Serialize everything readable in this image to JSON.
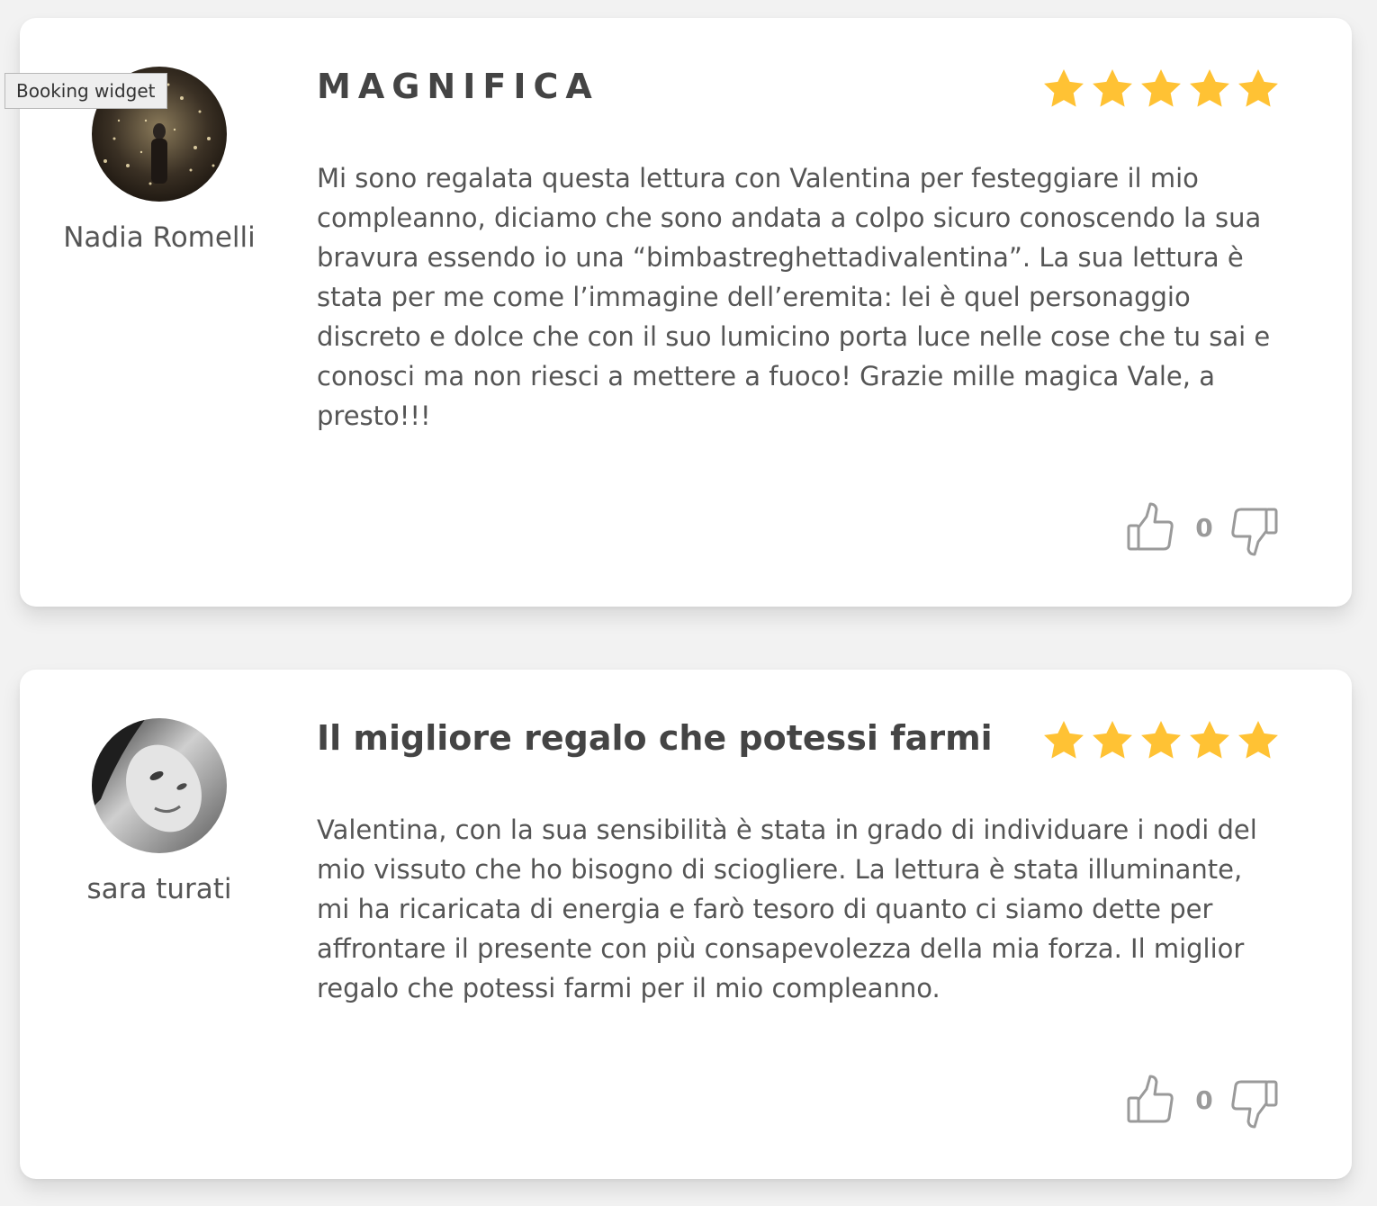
{
  "tooltip": {
    "label": "Booking widget"
  },
  "reviews": [
    {
      "author": "Nadia Romelli",
      "avatar_icon": "user-photo",
      "title": "MAGNIFICA",
      "rating": 5,
      "rating_max": 5,
      "body": "Mi sono regalata questa lettura con Valentina per festeggiare il mio compleanno, diciamo che sono andata a colpo sicuro conoscendo la sua bravura essendo io una “bimbastreghettadivalentina”. La sua lettura è stata per me come l’immagine dell’eremita: lei è quel personaggio discreto e dolce che con il suo lumicino porta luce nelle cose che tu sai e conosci ma non riesci a mettere a fuoco! Grazie mille magica Vale, a presto!!!",
      "vote_count": "0"
    },
    {
      "author": "sara turati",
      "avatar_icon": "user-photo",
      "title": "Il migliore regalo che potessi farmi",
      "rating": 5,
      "rating_max": 5,
      "body": "Valentina, con la sua sensibilità è stata in grado di individuare i nodi del mio vissuto che ho bisogno di sciogliere. La lettura è stata illuminante, mi ha ricaricata di energia e farò tesoro di quanto ci siamo dette per affrontare il presente con più consapevolezza della mia forza. Il miglior regalo che potessi farmi per il mio compleanno.",
      "vote_count": "0"
    }
  ],
  "colors": {
    "star": "#FFC234",
    "text": "#555555",
    "title": "#444444",
    "icon": "#9a9a9a",
    "background": "#f2f2f2",
    "card": "#ffffff"
  }
}
